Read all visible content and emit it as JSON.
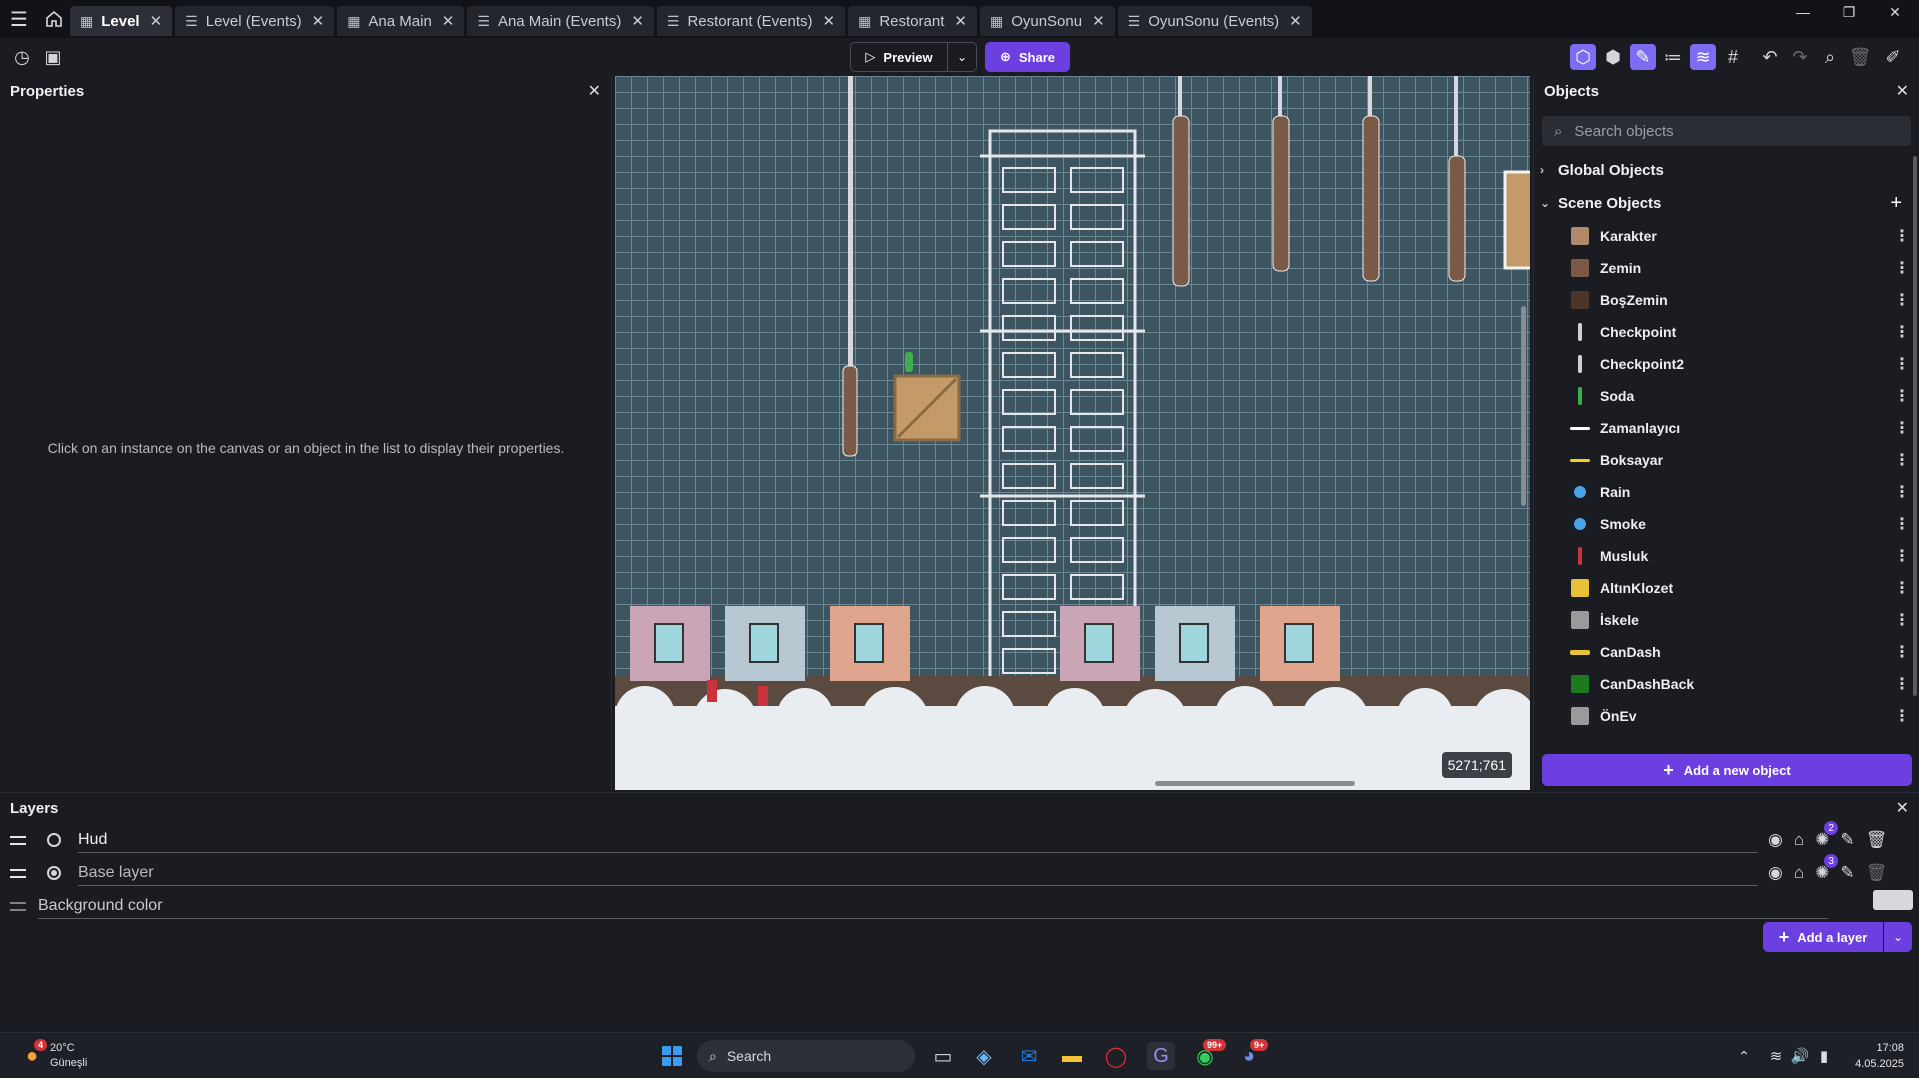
{
  "tabs": [
    {
      "label": "Level",
      "icon": "scene-icon",
      "active": true
    },
    {
      "label": "Level (Events)",
      "icon": "events-icon",
      "active": false
    },
    {
      "label": "Ana Main",
      "icon": "scene-icon",
      "active": false
    },
    {
      "label": "Ana Main (Events)",
      "icon": "events-icon",
      "active": false
    },
    {
      "label": "Restorant (Events)",
      "icon": "events-icon",
      "active": false
    },
    {
      "label": "Restorant",
      "icon": "scene-icon",
      "active": false
    },
    {
      "label": "OyunSonu",
      "icon": "scene-icon",
      "active": false
    },
    {
      "label": "OyunSonu (Events)",
      "icon": "events-icon",
      "active": false
    }
  ],
  "toolbar": {
    "preview_label": "Preview",
    "share_label": "Share"
  },
  "properties": {
    "title": "Properties",
    "hint": "Click on an instance on the canvas or an object in the list to display their properties."
  },
  "canvas": {
    "coords": "5271;761"
  },
  "objects": {
    "title": "Objects",
    "search_placeholder": "Search objects",
    "global_label": "Global Objects",
    "scene_label": "Scene Objects",
    "items": [
      {
        "name": "Karakter",
        "icon": "character-sprite",
        "color": "#b08a6a"
      },
      {
        "name": "Zemin",
        "icon": "ground-sprite",
        "color": "#7a5a46"
      },
      {
        "name": "BoşZemin",
        "icon": "ground-sprite",
        "color": "#4a3528"
      },
      {
        "name": "Checkpoint",
        "icon": "pole-sprite",
        "color": "#cfcfcf"
      },
      {
        "name": "Checkpoint2",
        "icon": "pole-sprite",
        "color": "#cfcfcf"
      },
      {
        "name": "Soda",
        "icon": "bottle-sprite",
        "color": "#3fae4a"
      },
      {
        "name": "Zamanlayıcı",
        "icon": "bar-sprite",
        "color": "#ffffff"
      },
      {
        "name": "Boksayar",
        "icon": "bar-sprite",
        "color": "#f2d21b"
      },
      {
        "name": "Rain",
        "icon": "particles-icon",
        "color": "#4aa3e8"
      },
      {
        "name": "Smoke",
        "icon": "particles-icon",
        "color": "#4aa3e8"
      },
      {
        "name": "Musluk",
        "icon": "hydrant-sprite",
        "color": "#c9343c"
      },
      {
        "name": "AltınKlozet",
        "icon": "toilet-sprite",
        "color": "#e8c03a"
      },
      {
        "name": "İskele",
        "icon": "scaffold-sprite",
        "color": "#9a9a9a"
      },
      {
        "name": "CanDash",
        "icon": "dash-sprite",
        "color": "#e8c03a"
      },
      {
        "name": "CanDashBack",
        "icon": "block-sprite",
        "color": "#1e7a1e"
      },
      {
        "name": "ÖnEv",
        "icon": "house-sprite",
        "color": "#9a9a9a"
      }
    ],
    "add_label": "Add a new object"
  },
  "layers": {
    "title": "Layers",
    "rows": [
      {
        "name": "Hud",
        "selected": false,
        "effects_count": "2"
      },
      {
        "name": "Base layer",
        "selected": true,
        "effects_count": "3"
      }
    ],
    "background_label": "Background color",
    "background_color": "#d7d8dc",
    "add_label": "Add a layer"
  },
  "taskbar": {
    "weather_temp": "20°C",
    "weather_desc": "Güneşli",
    "weather_badge": "4",
    "search_label": "Search",
    "whatsapp_badge": "99+",
    "discord_badge": "9+",
    "time": "17:08",
    "date": "4.05.2025"
  },
  "colors": {
    "accent": "#6b3fe0",
    "canvas_bg": "#3d5560"
  }
}
